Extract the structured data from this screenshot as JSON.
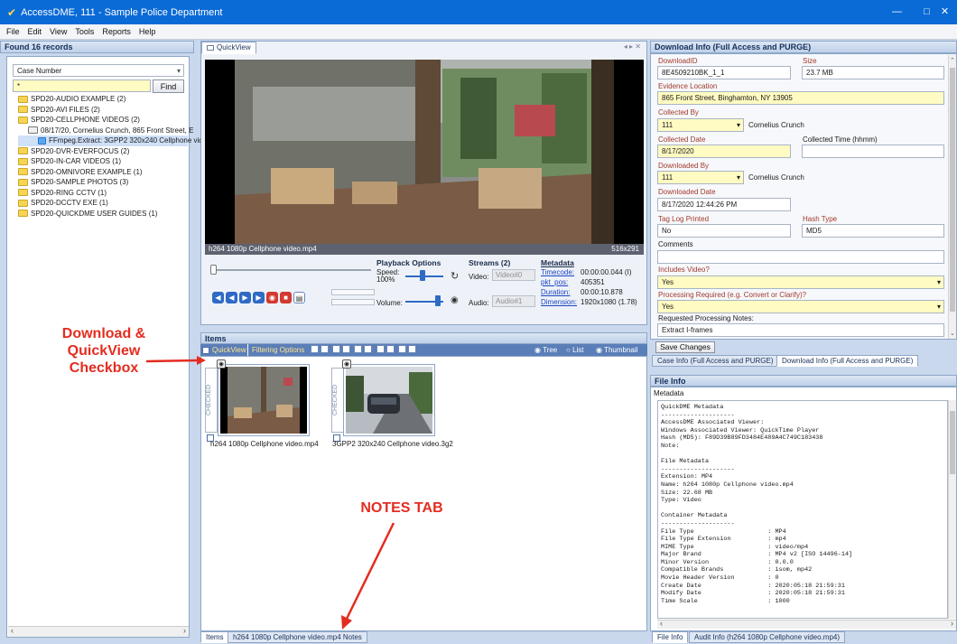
{
  "window": {
    "title": "AccessDME, 111 - Sample Police Department"
  },
  "menu": [
    "File",
    "Edit",
    "View",
    "Tools",
    "Reports",
    "Help"
  ],
  "left": {
    "header": "Found 16 records",
    "search_field": "Case Number",
    "search_value": "*",
    "find_label": "Find",
    "tree": [
      {
        "label": "SPD20-AUDIO EXAMPLE (2)",
        "level": 0,
        "icon": "folder-icon"
      },
      {
        "label": "SPD20-AVI FILES (2)",
        "level": 0,
        "icon": "folder-icon"
      },
      {
        "label": "SPD20-CELLPHONE VIDEOS (2)",
        "level": 0,
        "icon": "folder-icon"
      },
      {
        "label": "08/17/20, Cornelius Crunch, 865 Front Street, E",
        "level": 1,
        "icon": "evidence-icon"
      },
      {
        "label": "FFmpeg.Extract: 3GPP2 320x240 Cellphone vide",
        "level": 2,
        "icon": "file-icon"
      },
      {
        "label": "SPD20-DVR-EVERFOCUS (2)",
        "level": 0,
        "icon": "folder-icon"
      },
      {
        "label": "SPD20-IN-CAR VIDEOS (1)",
        "level": 0,
        "icon": "folder-icon"
      },
      {
        "label": "SPD20-OMNIVORE EXAMPLE (1)",
        "level": 0,
        "icon": "folder-icon"
      },
      {
        "label": "SPD20-SAMPLE PHOTOS (3)",
        "level": 0,
        "icon": "folder-icon"
      },
      {
        "label": "SPD20-RING CCTV (1)",
        "level": 0,
        "icon": "folder-icon"
      },
      {
        "label": "SPD20-DCCTV EXE (1)",
        "level": 0,
        "icon": "folder-icon"
      },
      {
        "label": "SPD20-QUICKDME USER GUIDES (1)",
        "level": 0,
        "icon": "folder-icon"
      }
    ]
  },
  "quickview": {
    "tab": "QuickView",
    "filename": "h264 1080p Cellphone video.mp4",
    "resolution": "516x291",
    "playback_title": "Playback Options",
    "speed_label": "Speed:",
    "speed_value": "100%",
    "volume_label": "Volume:",
    "streams_title": "Streams (2)",
    "video_label": "Video:",
    "video_stream": "Video#0",
    "audio_label": "Audio:",
    "audio_stream": "Audio#1",
    "metadata_title": "Metadata",
    "meta": [
      {
        "key": "Timecode:",
        "value": "00:00:00.044 (I)"
      },
      {
        "key": "pkt_pos:",
        "value": "405351"
      },
      {
        "key": "Duration:",
        "value": "00:00:10.878"
      },
      {
        "key": "Dimension:",
        "value": "1920x1080 (1.78)"
      }
    ]
  },
  "items": {
    "header": "Items",
    "quickview_check": "QuickView",
    "filtering_options": "Filtering Options",
    "view_tree": "Tree",
    "view_list": "List",
    "view_thumbnail": "Thumbnail",
    "checked_label": "CHECKED",
    "thumbs": [
      {
        "caption": "h264 1080p Cellphone video.mp4"
      },
      {
        "caption": "3GPP2 320x240 Cellphone video.3g2"
      }
    ],
    "bottom_tabs": [
      "Items",
      "h264 1080p Cellphone video.mp4 Notes"
    ]
  },
  "annotations": {
    "download": "Download &\nQuickView\nCheckbox",
    "notes": "NOTES TAB"
  },
  "download": {
    "header": "Download Info (Full Access and PURGE)",
    "download_id_label": "DownloadID",
    "download_id": "8E4509210BK_1_1",
    "size_label": "Size",
    "size": "23.7 MB",
    "evidence_location_label": "Evidence Location",
    "evidence_location": "865 Front Street, Binghamton, NY 13905",
    "collected_by_label": "Collected By",
    "collected_by_id": "111",
    "collected_by_name": "Cornelius Crunch",
    "collected_date_label": "Collected Date",
    "collected_date": "8/17/2020",
    "collected_time_label": "Collected Time (hhmm)",
    "downloaded_by_label": "Downloaded By",
    "downloaded_by_id": "111",
    "downloaded_by_name": "Cornelius Crunch",
    "downloaded_date_label": "Downloaded Date",
    "downloaded_date": "8/17/2020 12:44:26 PM",
    "tag_log_label": "Tag Log Printed",
    "tag_log": "No",
    "hash_type_label": "Hash Type",
    "hash_type": "MD5",
    "comments_label": "Comments",
    "includes_video_label": "Includes Video?",
    "includes_video": "Yes",
    "processing_label": "Processing Required (e.g. Convert or Clarify)?",
    "processing": "Yes",
    "requested_notes_label": "Requested Processing Notes:",
    "requested_notes": "Extract I-frames",
    "save_label": "Save Changes",
    "tabs": [
      "Case Info (Full Access and PURGE)",
      "Download Info (Full Access and PURGE)"
    ]
  },
  "fileinfo": {
    "header": "File Info",
    "sub": "Metadata",
    "text": "QuickDME Metadata\n--------------------\nAccessDME Associated Viewer:\nWindows Associated Viewer: QuickTime Player\nHash (MD5): F89D39B89FD3484E489A4C749C183438\nNote:\n\nFile Metadata\n--------------------\nExtension: MP4\nName: h264 1080p Cellphone video.mp4\nSize: 22.68 MB\nType: Video\n\nContainer Metadata\n--------------------\nFile Type                    : MP4\nFile Type Extension          : mp4\nMIME Type                    : video/mp4\nMajor Brand                  : MP4 v2 [ISO 14496-14]\nMinor Version                : 0.0.0\nCompatible Brands            : isom, mp42\nMovie Header Version         : 0\nCreate Date                  : 2020:05:18 21:59:31\nModify Date                  : 2020:05:18 21:59:31\nTime Scale                   : 1000",
    "tabs": [
      "File Info",
      "Audit Info (h264 1080p Cellphone video.mp4)"
    ]
  }
}
